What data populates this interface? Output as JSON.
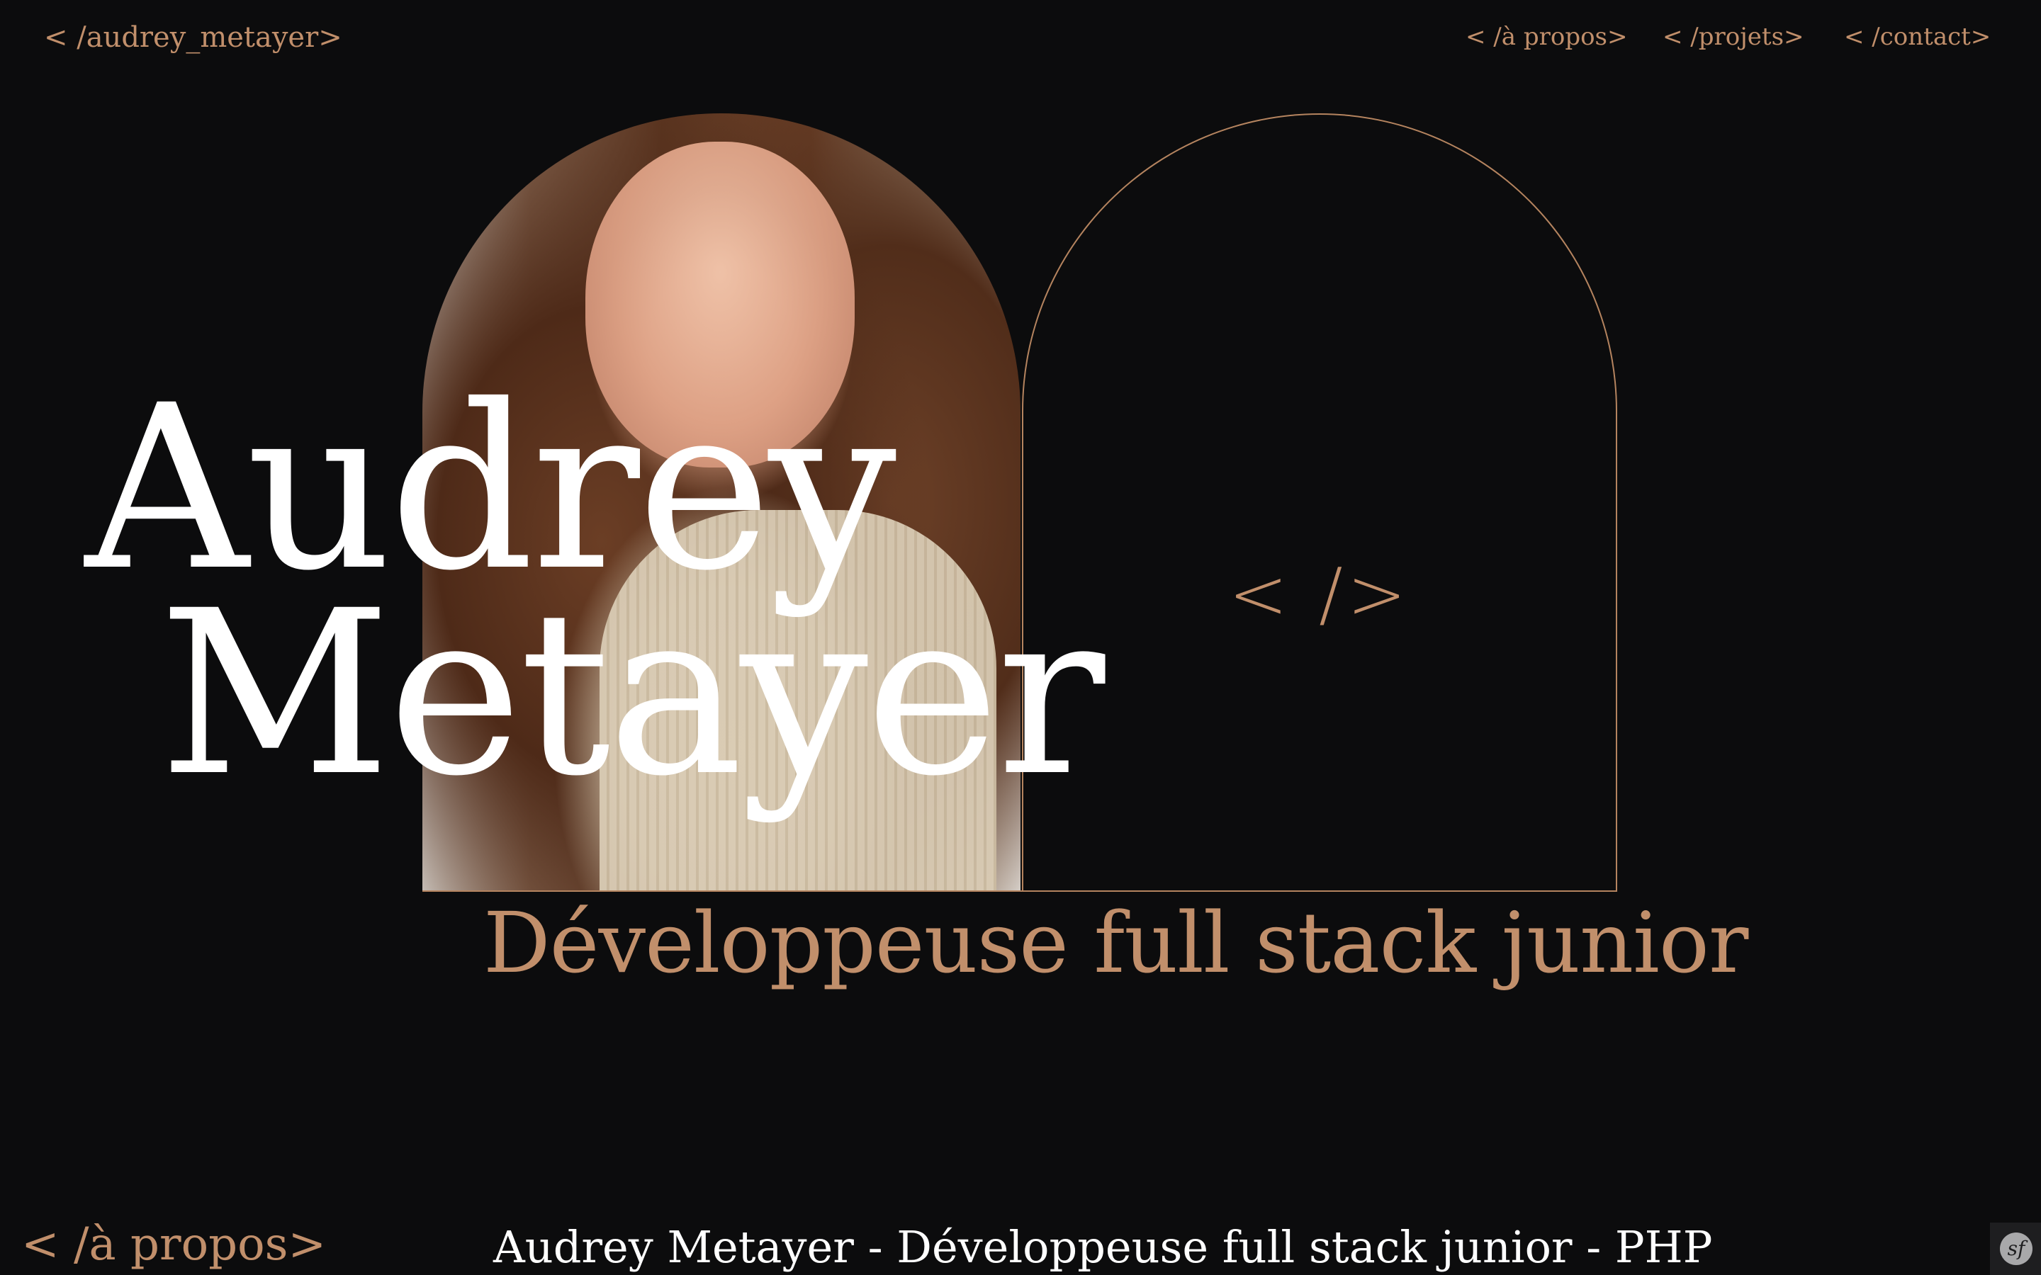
{
  "header": {
    "logo": "< /audrey_metayer>",
    "nav": [
      {
        "label": "< /à propos>"
      },
      {
        "label": "< /projets>"
      },
      {
        "label": "< /contact>"
      }
    ]
  },
  "hero": {
    "first_name": "Audrey",
    "last_name": "Metayer",
    "code_symbol": "< />",
    "subtitle": "Développeuse full stack junior"
  },
  "about": {
    "section_title": "< /à propos>",
    "caption": "Audrey Metayer - Développeuse full stack junior - PHP"
  },
  "toolbar": {
    "badge_label": "sf"
  },
  "colors": {
    "background": "#0c0c0d",
    "accent": "#c18f6b",
    "text": "#ffffff"
  }
}
